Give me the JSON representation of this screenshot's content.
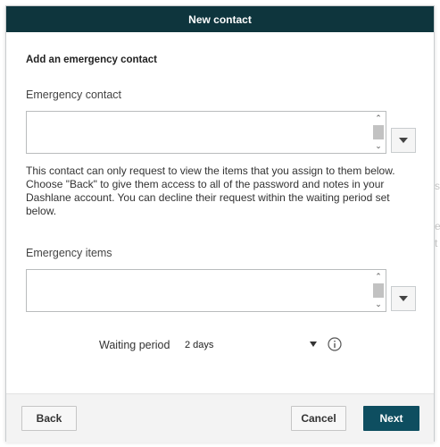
{
  "dialog": {
    "title": "New contact",
    "section_title": "Add an emergency contact",
    "emergency_contact": {
      "label": "Emergency contact"
    },
    "help_text": "This contact can only request to view the items that you assign to them below. Choose \"Back\" to give them access to all of the password and notes in your Dashlane account. You can decline their request within the waiting period set below.",
    "emergency_items": {
      "label": "Emergency items"
    },
    "waiting_period": {
      "label": "Waiting period",
      "value": "2 days"
    },
    "footer": {
      "back_label": "Back",
      "cancel_label": "Cancel",
      "next_label": "Next"
    }
  },
  "background": {
    "letters": [
      "s",
      "e",
      "t"
    ]
  },
  "colors": {
    "titlebar": "#0e353d",
    "primary_button": "#0e4e60"
  }
}
